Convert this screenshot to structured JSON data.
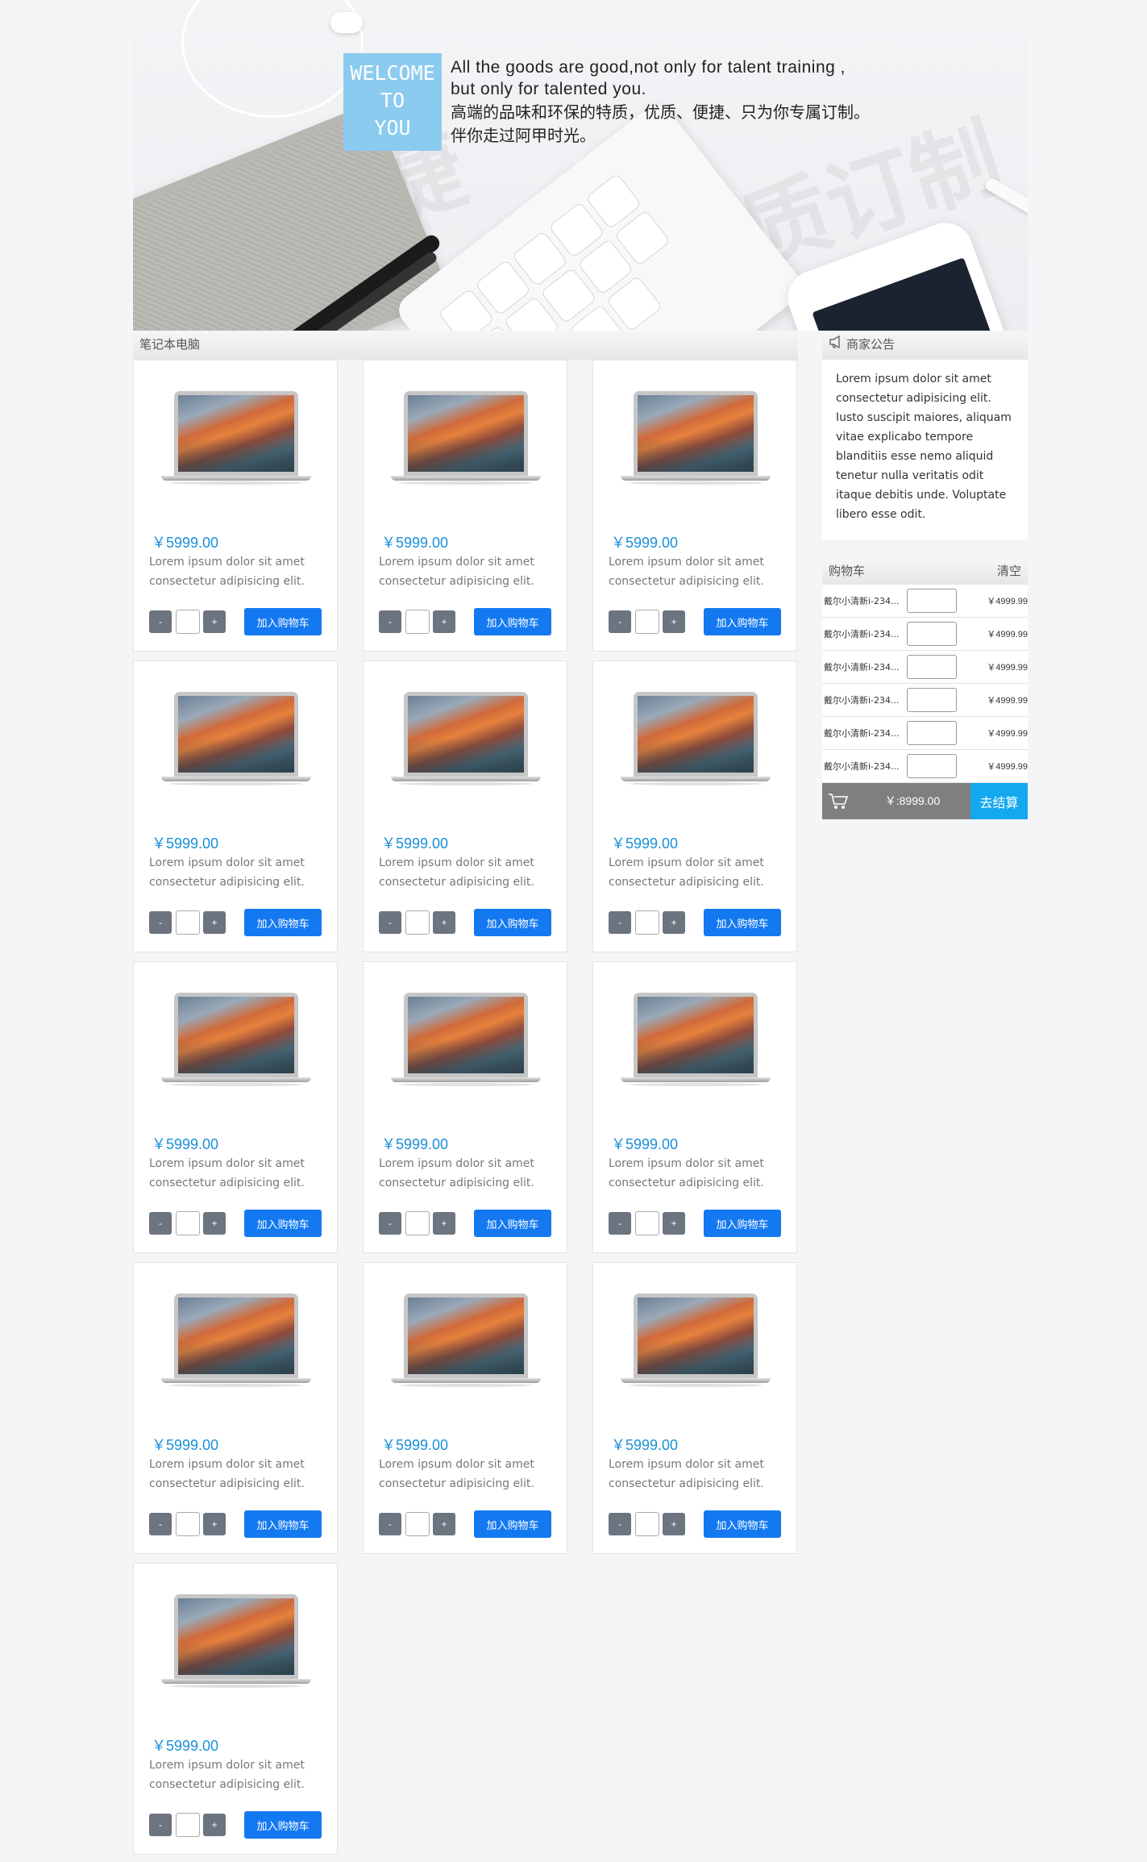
{
  "banner": {
    "welcome": [
      "WELCOME",
      "TO",
      "YOU"
    ],
    "text_en_1": "All the goods are good,not only for talent training ,",
    "text_en_2": "but only for talented you.",
    "text_cn_1": "高端的品味和环保的特质，优质、便捷、只为你专属订制。",
    "text_cn_2": "伴你走过阿甲时光。",
    "watermark_1": "便捷",
    "watermark_2": "优质订制"
  },
  "category": {
    "title": "笔记本电脑"
  },
  "products": [
    {
      "price": "￥5999.00",
      "desc": "Lorem ipsum dolor sit amet consectetur adipisicing elit.",
      "minus": "-",
      "plus": "+",
      "add": "加入购物车"
    },
    {
      "price": "￥5999.00",
      "desc": "Lorem ipsum dolor sit amet consectetur adipisicing elit.",
      "minus": "-",
      "plus": "+",
      "add": "加入购物车"
    },
    {
      "price": "￥5999.00",
      "desc": "Lorem ipsum dolor sit amet consectetur adipisicing elit.",
      "minus": "-",
      "plus": "+",
      "add": "加入购物车"
    },
    {
      "price": "￥5999.00",
      "desc": "Lorem ipsum dolor sit amet consectetur adipisicing elit.",
      "minus": "-",
      "plus": "+",
      "add": "加入购物车"
    },
    {
      "price": "￥5999.00",
      "desc": "Lorem ipsum dolor sit amet consectetur adipisicing elit.",
      "minus": "-",
      "plus": "+",
      "add": "加入购物车"
    },
    {
      "price": "￥5999.00",
      "desc": "Lorem ipsum dolor sit amet consectetur adipisicing elit.",
      "minus": "-",
      "plus": "+",
      "add": "加入购物车"
    },
    {
      "price": "￥5999.00",
      "desc": "Lorem ipsum dolor sit amet consectetur adipisicing elit.",
      "minus": "-",
      "plus": "+",
      "add": "加入购物车"
    },
    {
      "price": "￥5999.00",
      "desc": "Lorem ipsum dolor sit amet consectetur adipisicing elit.",
      "minus": "-",
      "plus": "+",
      "add": "加入购物车"
    },
    {
      "price": "￥5999.00",
      "desc": "Lorem ipsum dolor sit amet consectetur adipisicing elit.",
      "minus": "-",
      "plus": "+",
      "add": "加入购物车"
    },
    {
      "price": "￥5999.00",
      "desc": "Lorem ipsum dolor sit amet consectetur adipisicing elit.",
      "minus": "-",
      "plus": "+",
      "add": "加入购物车"
    },
    {
      "price": "￥5999.00",
      "desc": "Lorem ipsum dolor sit amet consectetur adipisicing elit.",
      "minus": "-",
      "plus": "+",
      "add": "加入购物车"
    },
    {
      "price": "￥5999.00",
      "desc": "Lorem ipsum dolor sit amet consectetur adipisicing elit.",
      "minus": "-",
      "plus": "+",
      "add": "加入购物车"
    },
    {
      "price": "￥5999.00",
      "desc": "Lorem ipsum dolor sit amet consectetur adipisicing elit.",
      "minus": "-",
      "plus": "+",
      "add": "加入购物车"
    }
  ],
  "notice": {
    "title": "商家公告",
    "body": "Lorem ipsum dolor sit amet consectetur adipisicing elit. Iusto suscipit maiores, aliquam vitae explicabo tempore blanditiis esse nemo aliquid tenetur nulla veritatis odit itaque debitis unde. Voluptate libero esse odit."
  },
  "cart": {
    "title": "购物车",
    "clear": "清空",
    "items": [
      {
        "name": "戴尔小清新i-234...",
        "price": "￥4999.99"
      },
      {
        "name": "戴尔小清新i-234...",
        "price": "￥4999.99"
      },
      {
        "name": "戴尔小清新i-234...",
        "price": "￥4999.99"
      },
      {
        "name": "戴尔小清新i-234...",
        "price": "￥4999.99"
      },
      {
        "name": "戴尔小清新i-234...",
        "price": "￥4999.99"
      },
      {
        "name": "戴尔小清新i-234...",
        "price": "￥4999.99"
      }
    ],
    "total": "￥:8999.00",
    "checkout": "去结算"
  },
  "colors": {
    "price": "#1a8fd8",
    "add_button": "#1479f0",
    "checkout": "#14a9ef",
    "welcome_box": "#8ccbf0"
  },
  "icons": {
    "notice": "megaphone-icon",
    "cart": "cart-icon"
  }
}
